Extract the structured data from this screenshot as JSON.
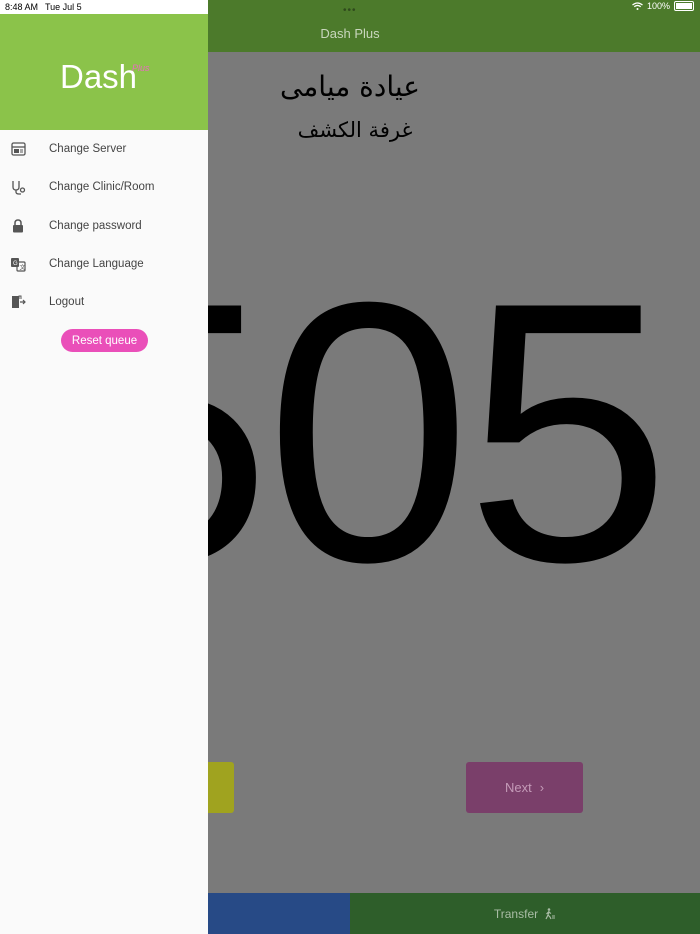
{
  "statusbar": {
    "time": "8:48 AM",
    "date": "Tue Jul 5",
    "battery": "100%"
  },
  "main": {
    "appbar_title": "Dash Plus",
    "appbar_dots": "•••",
    "clinic_name": "عيادة ميامى",
    "room_name": "غرفة الكشف",
    "queue_number": "505",
    "next_label": "Next",
    "next_chevron": "›",
    "transfer_label": "Transfer"
  },
  "drawer": {
    "logo": "Dash",
    "logo_sup": "Plus",
    "menu": [
      {
        "icon": "server-icon",
        "label": "Change Server"
      },
      {
        "icon": "clinic-icon",
        "label": "Change Clinic/Room"
      },
      {
        "icon": "lock-icon",
        "label": "Change password"
      },
      {
        "icon": "translate-icon",
        "label": "Change Language"
      },
      {
        "icon": "logout-icon",
        "label": "Logout"
      }
    ],
    "reset_label": "Reset queue"
  },
  "colors": {
    "drawer_header": "#8bc34a",
    "reset_button": "#ea4fb9",
    "appbar": "#4c7a2b",
    "next_button": "#7a3f6a",
    "bottom_left": "#274a86",
    "bottom_right": "#2e5e2a"
  }
}
